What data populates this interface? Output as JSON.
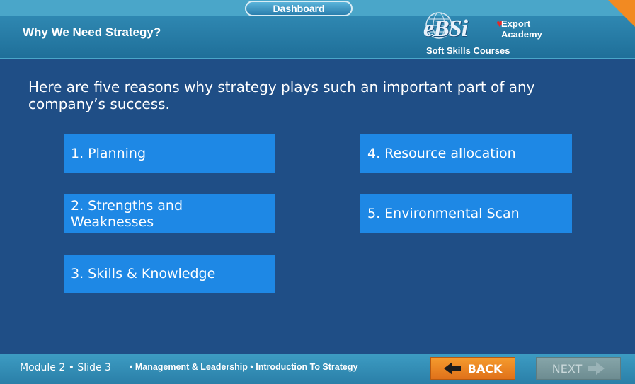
{
  "header": {
    "dashboard_label": "Dashboard",
    "title": "Why We Need Strategy?",
    "logo": {
      "brand": "eBSi",
      "line1": "Export",
      "line2": "Academy",
      "subtitle": "Soft Skills Courses"
    }
  },
  "intro": "Here are five reasons why strategy plays such an important part of any company’s success.",
  "reasons": [
    {
      "label": "1. Planning"
    },
    {
      "label": "2. Strengths and Weaknesses"
    },
    {
      "label": "3. Skills & Knowledge"
    },
    {
      "label": "4. Resource allocation"
    },
    {
      "label": "5. Environmental Scan"
    }
  ],
  "footer": {
    "module_slide": "Module 2 • Slide 3",
    "crumbs": "• Management & Leadership  • Introduction To Strategy",
    "back_label": "BACK",
    "next_label": "NEXT"
  },
  "colors": {
    "accent_orange": "#f28a22",
    "box_blue": "#1e88e5",
    "background": "#1f4e86"
  }
}
